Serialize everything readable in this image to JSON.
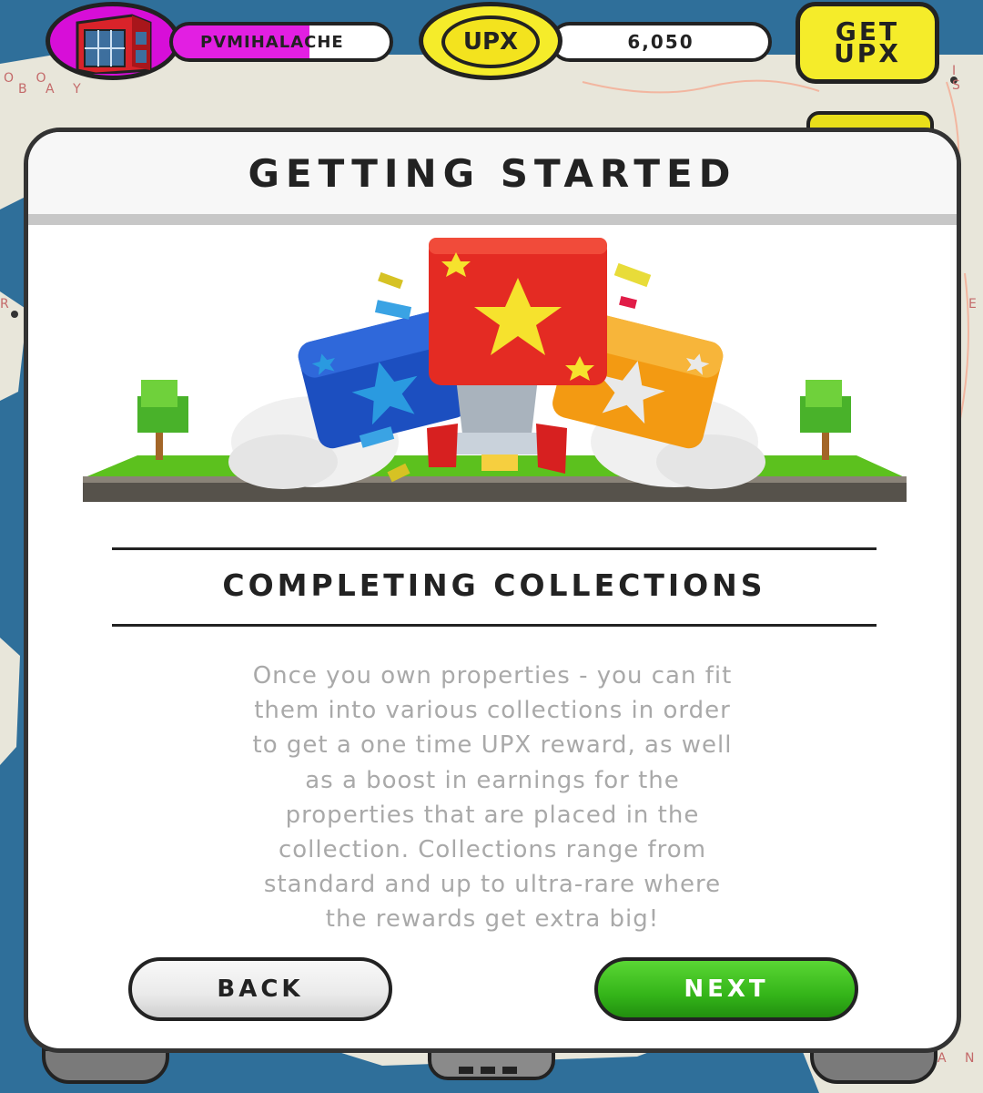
{
  "hud": {
    "username": "PVMIHALACHE",
    "currency_label": "UPX",
    "balance": "6,050",
    "get_upx_line1": "GET",
    "get_upx_line2": "UPX",
    "avatar_icon": "building-icon",
    "coin_icon": "upx-coin-icon"
  },
  "map_labels": {
    "bay_top": "O O",
    "bay_bottom": "B A Y",
    "right_top": "I S",
    "right_mid": "E",
    "left_mid": "R",
    "bottom_right": "A N"
  },
  "modal": {
    "title": "GETTING STARTED",
    "illustration_icon": "rocket-collections-illustration",
    "section_title": "COMPLETING COLLECTIONS",
    "body_lines": [
      "Once you own properties - you can fit",
      "them into various collections in order",
      "to get a one time UPX reward, as well",
      "as a boost in earnings for the",
      "properties that are placed in the",
      "collection. Collections range from",
      "standard and up to ultra-rare where",
      "the rewards get extra big!"
    ],
    "back_label": "BACK",
    "next_label": "NEXT"
  },
  "colors": {
    "avatar_bg": "#d70ed8",
    "upx_yellow": "#f5ec2a",
    "next_green": "#34b519",
    "body_text": "#a9a9a9",
    "map_water": "#2f6f9a",
    "map_land": "#e8e6da"
  }
}
